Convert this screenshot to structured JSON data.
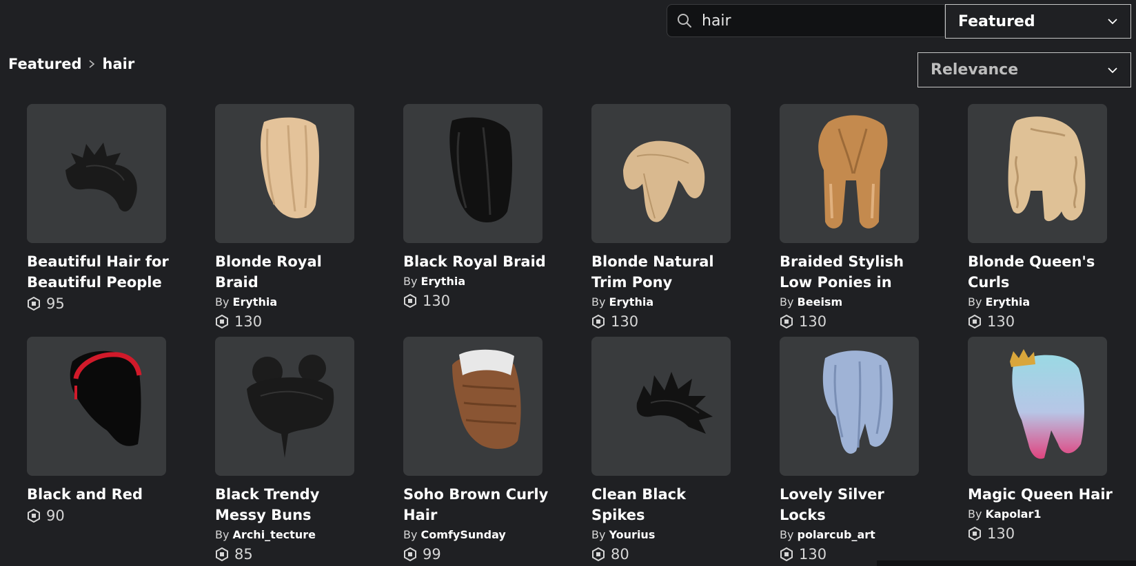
{
  "search": {
    "value": "hair",
    "placeholder": ""
  },
  "category_dropdown": {
    "selected": "Featured"
  },
  "sort_dropdown": {
    "selected": "Relevance"
  },
  "breadcrumb": {
    "parent": "Featured",
    "current": "hair"
  },
  "colors": {
    "background": "#1f2023",
    "card": "#393b3d",
    "search_bg": "#111214"
  },
  "items": [
    {
      "name": "Beautiful Hair for Beautiful People",
      "by_label": "",
      "creator": "",
      "price": "95",
      "icon": "black-spiky-hair-icon"
    },
    {
      "name": "Blonde Royal Braid",
      "by_label": "By",
      "creator": "Erythia",
      "price": "130",
      "icon": "blonde-braid-hair-icon"
    },
    {
      "name": "Black Royal Braid",
      "by_label": "By",
      "creator": "Erythia",
      "price": "130",
      "icon": "black-braid-hair-icon"
    },
    {
      "name": "Blonde Natural Trim Pony",
      "by_label": "By",
      "creator": "Erythia",
      "price": "130",
      "icon": "blonde-pony-hair-icon"
    },
    {
      "name": "Braided Stylish Low Ponies in",
      "by_label": "By",
      "creator": "Beeism",
      "price": "130",
      "icon": "braided-ponies-hair-icon"
    },
    {
      "name": "Blonde Queen's Curls",
      "by_label": "By",
      "creator": "Erythia",
      "price": "130",
      "icon": "blonde-curls-hair-icon"
    },
    {
      "name": "Black and Red",
      "by_label": "",
      "creator": "",
      "price": "90",
      "icon": "black-red-hair-icon"
    },
    {
      "name": "Black Trendy Messy Buns",
      "by_label": "By",
      "creator": "Archi_tecture",
      "price": "85",
      "icon": "black-buns-hair-icon"
    },
    {
      "name": "Soho Brown Curly Hair",
      "by_label": "By",
      "creator": "ComfySunday",
      "price": "99",
      "icon": "brown-curly-hair-icon"
    },
    {
      "name": "Clean Black Spikes",
      "by_label": "By",
      "creator": "Yourius",
      "price": "80",
      "icon": "black-spikes-hair-icon"
    },
    {
      "name": "Lovely Silver Locks",
      "by_label": "By",
      "creator": "polarcub_art",
      "price": "130",
      "icon": "silver-locks-hair-icon"
    },
    {
      "name": "Magic Queen Hair",
      "by_label": "By",
      "creator": "Kapolar1",
      "price": "130",
      "icon": "magic-queen-hair-icon"
    }
  ]
}
